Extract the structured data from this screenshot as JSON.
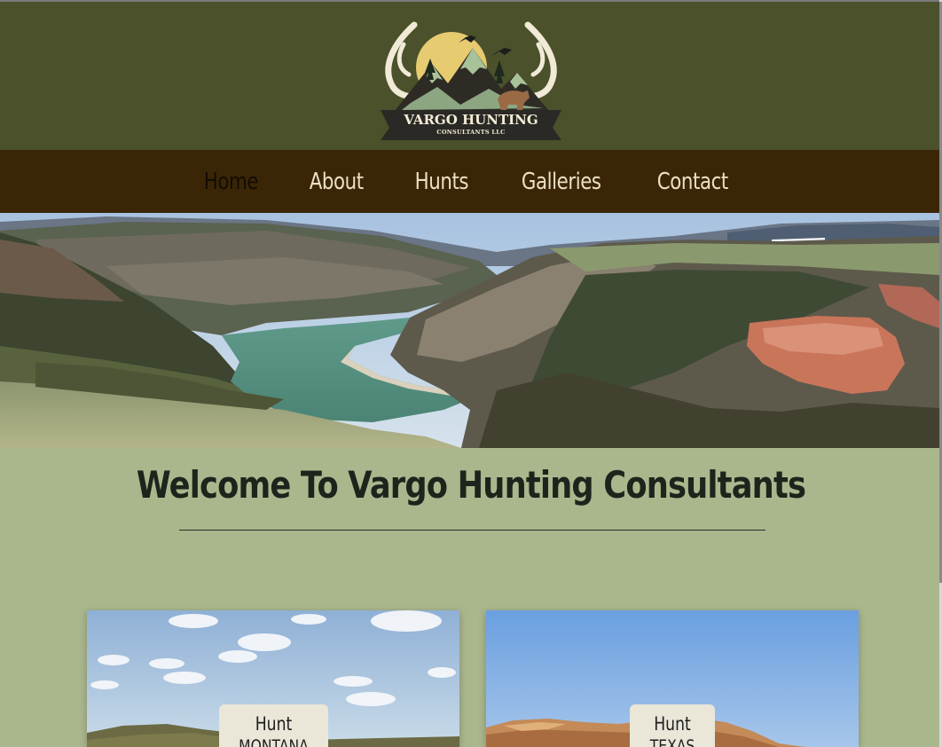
{
  "header": {
    "logo": {
      "title": "VARGO HUNTING",
      "subtitle": "CONSULTANTS LLC",
      "icon": "antler-mountain-sun-logo"
    }
  },
  "nav": {
    "items": [
      {
        "label": "Home",
        "active": true
      },
      {
        "label": "About",
        "active": false
      },
      {
        "label": "Hunts",
        "active": false
      },
      {
        "label": "Galleries",
        "active": false
      },
      {
        "label": "Contact",
        "active": false
      }
    ]
  },
  "hero": {
    "image": "canyon-lake-landscape"
  },
  "welcome": {
    "title": "Welcome To Vargo Hunting Consultants"
  },
  "cards": [
    {
      "line1": "Hunt",
      "line2": "MONTANA",
      "image": "montana-prairie-sky"
    },
    {
      "line1": "Hunt",
      "line2": "TEXAS",
      "image": "texas-desert-mountains"
    }
  ],
  "colors": {
    "header_bg": "#4a512b",
    "nav_bg": "#3a2606",
    "nav_text": "#ecdfc4",
    "nav_active": "#120d02",
    "page_bg": "#aab78d",
    "card_label_bg": "#eae6d8"
  }
}
